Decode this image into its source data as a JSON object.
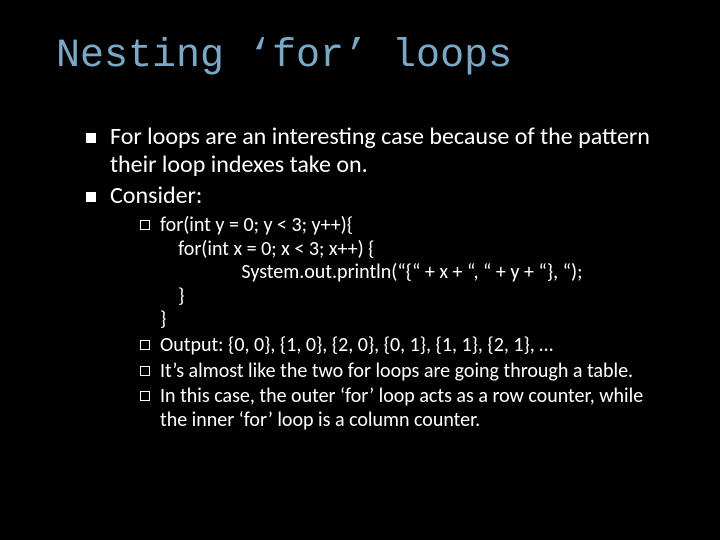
{
  "title": "Nesting ‘for’ loops",
  "bullets": {
    "b1": "For loops are an interesting case because of the pattern their loop indexes take on.",
    "b2": "Consider:"
  },
  "sub": {
    "code": "for(int y = 0; y < 3; y++){\n    for(int x = 0; x < 3; x++) {\n                  System.out.println(“{“ + x + “, “ + y + “}, “);\n    }\n}",
    "output": "Output: {0, 0}, {1, 0}, {2, 0}, {0, 1}, {1, 1}, {2, 1}, …",
    "almost": "It’s almost like the two for loops are going through a table.",
    "inthis": "In this case, the outer ‘for’ loop acts as a row counter, while the inner ‘for’ loop is a column counter."
  }
}
